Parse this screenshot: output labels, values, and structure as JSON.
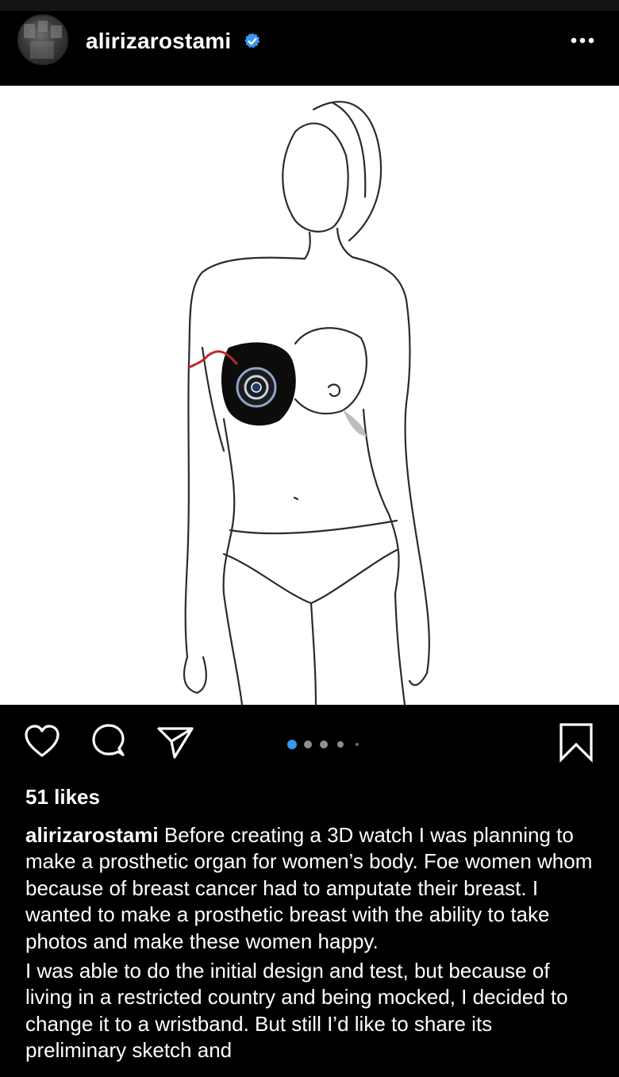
{
  "post": {
    "username": "alirizarostami",
    "verified": true,
    "likes": "51 likes",
    "caption_username": "alirizarostami",
    "caption_p1": " Before creating a 3D watch I was planning to make a prosthetic organ for women’s body. Foe women whom because of breast cancer had to amputate their breast.  I wanted to make a prosthetic breast with the ability to take photos and make these women happy.",
    "caption_p2": "I was able to do the initial design and test, but because of living in a restricted country and being mocked, I decided to change it to a wristband.  But still I’d like to share its preliminary sketch and",
    "carousel": {
      "count": 5,
      "active_index": 0
    }
  },
  "icons": {
    "verified": "verified-badge-icon",
    "more": "more-options-icon",
    "like": "heart-icon",
    "comment": "comment-bubble-icon",
    "share": "send-icon",
    "save": "bookmark-icon"
  },
  "colors": {
    "background": "#000000",
    "text": "#ffffff",
    "verified_blue": "#3897f0",
    "carousel_active": "#3897f0",
    "carousel_inactive": "#8e8e8e",
    "accent_red": "#c0262d"
  }
}
